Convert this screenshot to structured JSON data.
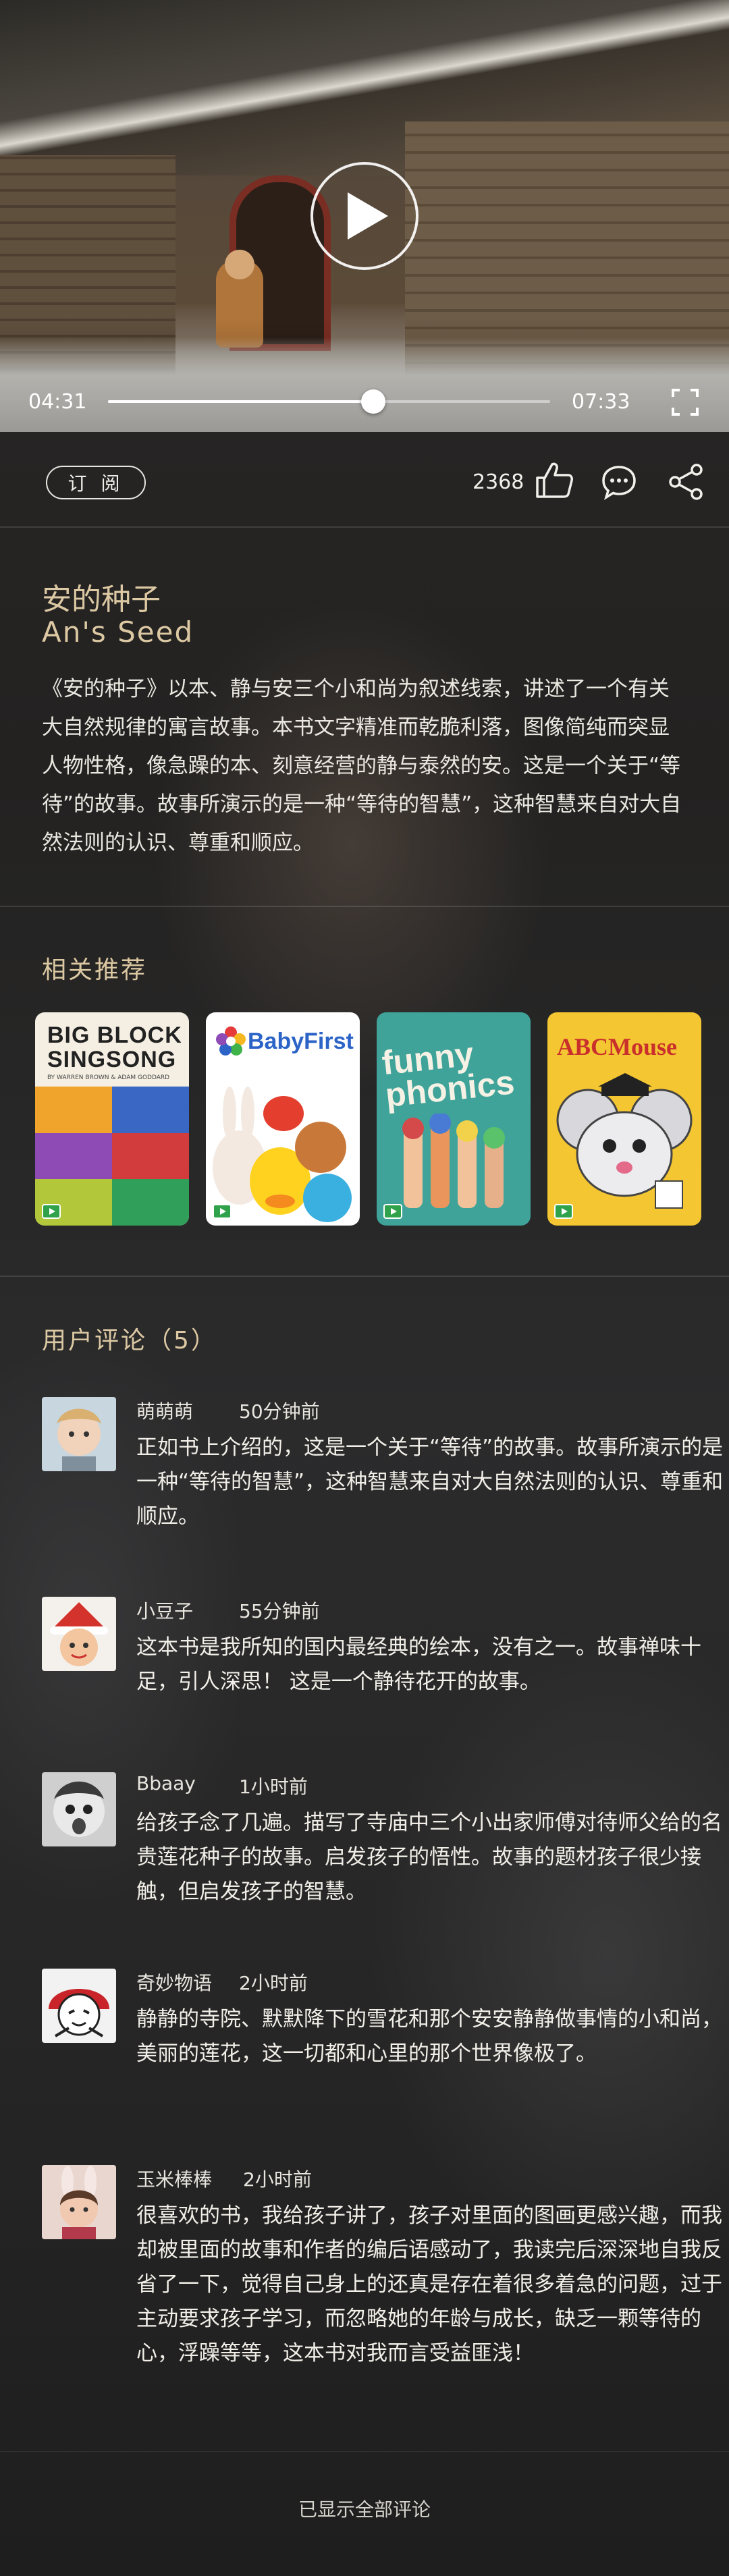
{
  "player": {
    "current_time": "04:31",
    "duration": "07:33",
    "progress": 0.6
  },
  "actions": {
    "subscribe_label": "订 阅",
    "like_count": "2368"
  },
  "book": {
    "title_cn": "安的种子",
    "title_en": "An's Seed",
    "description": "《安的种子》以本、静与安三个小和尚为叙述线索，讲述了一个有关大自然规律的寓言故事。本书文字精准而乾脆利落，图像简纯而突显人物性格，像急躁的本、刻意经营的静与泰然的安。这是一个关于“等待”的故事。故事所演示的是一种“等待的智慧”，这种智慧来自对大自然法则的认识、尊重和顺应。"
  },
  "recommendations": {
    "title": "相关推荐",
    "items": [
      {
        "title": "BIG BLOCK SINGSONG",
        "subtitle": "BY WARREN BROWN & ADAM GODDARD"
      },
      {
        "title": "BabyFirst"
      },
      {
        "title": "funny phonics"
      },
      {
        "title": "ABCMouse"
      }
    ]
  },
  "comments": {
    "title": "用户评论（5）",
    "items": [
      {
        "user": "萌萌萌",
        "time": "50分钟前",
        "text": "正如书上介绍的，这是一个关于“等待”的故事。故事所演示的是一种“等待的智慧”，这种智慧来自对大自然法则的认识、尊重和顺应。"
      },
      {
        "user": "小豆子",
        "time": "55分钟前",
        "text": "这本书是我所知的国内最经典的绘本，没有之一。故事禅味十足，引人深思！ 这是一个静待花开的故事。"
      },
      {
        "user": "Bbaay",
        "time": "1小时前",
        "text": "给孩子念了几遍。描写了寺庙中三个小出家师傅对待师父给的名贵莲花种子的故事。启发孩子的悟性。故事的题材孩子很少接触，但启发孩子的智慧。"
      },
      {
        "user": "奇妙物语",
        "time": "2小时前",
        "text": "静静的寺院、默默降下的雪花和那个安安静静做事情的小和尚，美丽的莲花，这一切都和心里的那个世界像极了。"
      },
      {
        "user": "玉米棒棒",
        "time": "2小时前",
        "text": "很喜欢的书，我给孩子讲了，孩子对里面的图画更感兴趣，而我却被里面的故事和作者的编后语感动了，我读完后深深地自我反省了一下，觉得自己身上的还真是存在着很多着急的问题，过于主动要求孩子学习，而忽略她的年龄与成长，缺乏一颗等待的心，浮躁等等，这本书对我而言受益匪浅！"
      }
    ],
    "footer": "已显示全部评论"
  },
  "colors": {
    "accent_gold": "#dcc9a3",
    "background": "#252423"
  }
}
